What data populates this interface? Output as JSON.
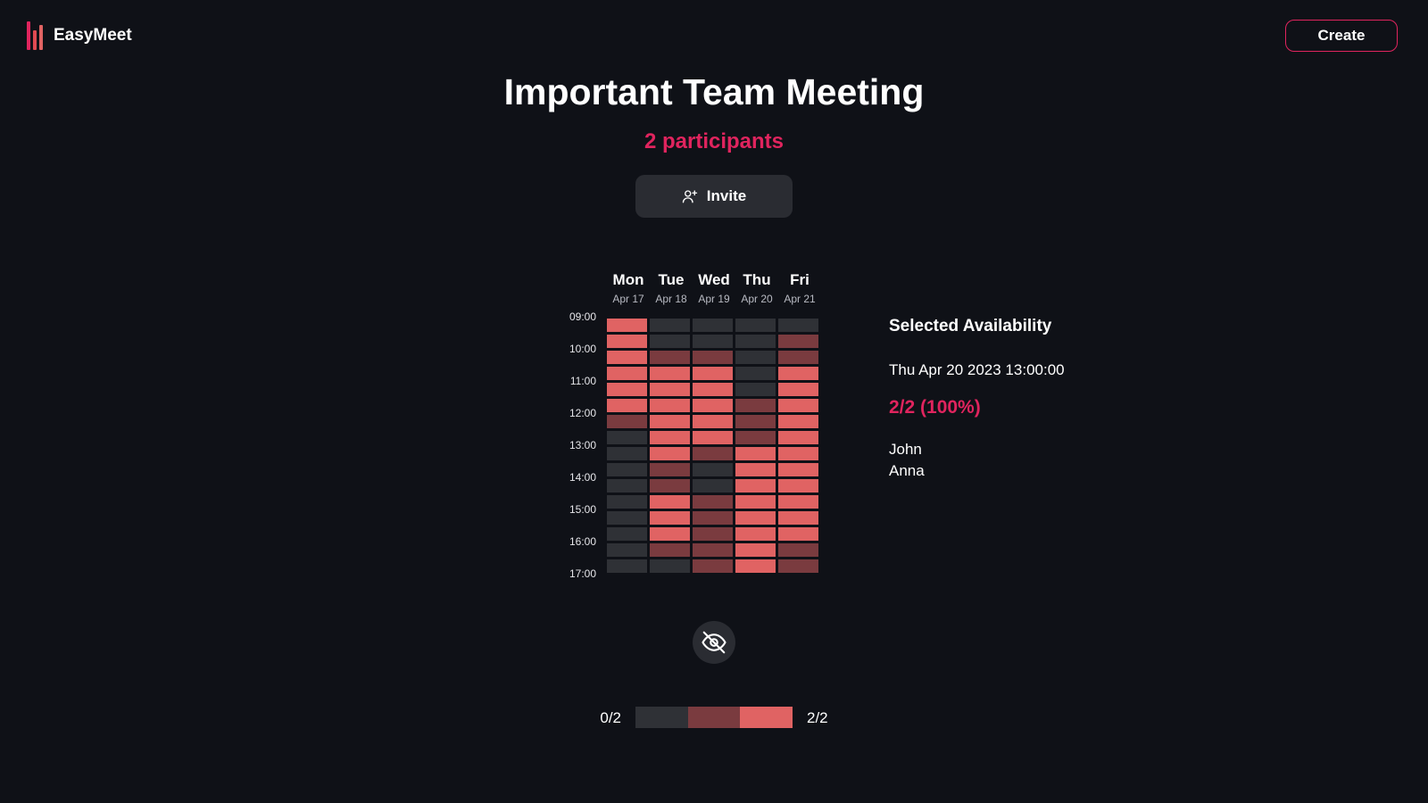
{
  "header": {
    "brand": "EasyMeet",
    "create_label": "Create"
  },
  "meeting": {
    "title": "Important Team Meeting",
    "participants_label": "2 participants",
    "invite_label": "Invite"
  },
  "grid": {
    "days": [
      {
        "name": "Mon",
        "date": "Apr 17"
      },
      {
        "name": "Tue",
        "date": "Apr 18"
      },
      {
        "name": "Wed",
        "date": "Apr 19"
      },
      {
        "name": "Thu",
        "date": "Apr 20"
      },
      {
        "name": "Fri",
        "date": "Apr 21"
      }
    ],
    "times": [
      "09:00",
      "10:00",
      "11:00",
      "12:00",
      "13:00",
      "14:00",
      "15:00",
      "16:00",
      "17:00"
    ],
    "availability": [
      [
        2,
        2,
        2,
        2,
        2,
        2,
        1,
        0,
        0,
        0,
        0,
        0,
        0,
        0,
        0,
        0
      ],
      [
        0,
        0,
        1,
        2,
        2,
        2,
        2,
        2,
        2,
        1,
        1,
        2,
        2,
        2,
        1,
        0
      ],
      [
        0,
        0,
        1,
        2,
        2,
        2,
        2,
        2,
        1,
        0,
        0,
        1,
        1,
        1,
        1,
        1
      ],
      [
        0,
        0,
        0,
        0,
        0,
        1,
        1,
        1,
        2,
        2,
        2,
        2,
        2,
        2,
        2,
        2
      ],
      [
        0,
        1,
        1,
        2,
        2,
        2,
        2,
        2,
        2,
        2,
        2,
        2,
        2,
        2,
        1,
        1
      ]
    ],
    "level_colors": [
      "#2f3136",
      "#7a3b3f",
      "#e06363"
    ]
  },
  "legend": {
    "min_label": "0/2",
    "max_label": "2/2"
  },
  "selection": {
    "title": "Selected Availability",
    "datetime": "Thu Apr 20 2023 13:00:00",
    "score": "2/2 (100%)",
    "names": [
      "John",
      "Anna"
    ]
  },
  "colors": {
    "accent": "#e0245e",
    "background": "#0f1117",
    "button_bg": "#2a2c32"
  },
  "icons": {
    "brand": "bar-chart-logo-icon",
    "invite": "user-plus-icon",
    "visibility": "eye-off-icon"
  }
}
